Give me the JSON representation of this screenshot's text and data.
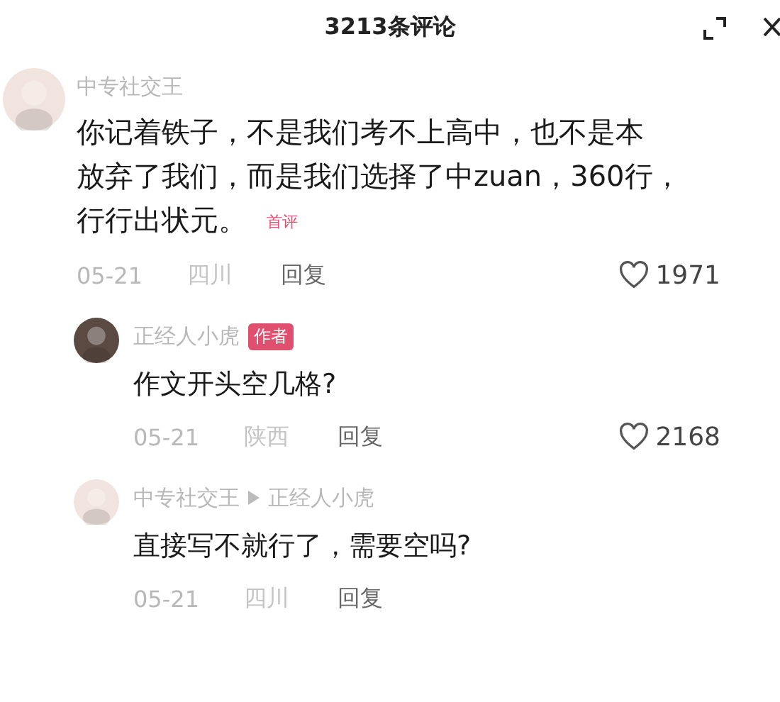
{
  "header": {
    "title": "3213条评论"
  },
  "comments": [
    {
      "kind": "top",
      "color": "#f1e4de",
      "names": [
        "中专社交王"
      ],
      "lines": [
        "你记着铁子，不是我们考不上高中，也不是本",
        "放弃了我们，而是我们选择了中zuan，360行，",
        "行行出状元。"
      ],
      "tag": "首评",
      "date": "05-21",
      "region": "四川",
      "reply": "回复",
      "likes": "1971"
    },
    {
      "kind": "reply",
      "color": "#5a4a42",
      "names": [
        "正经人小虎"
      ],
      "badge": "作者",
      "lines": [
        "作文开头空几格?"
      ],
      "date": "05-21",
      "region": "陕西",
      "reply": "回复",
      "likes": "2168"
    },
    {
      "kind": "reply",
      "color": "#f1e4de",
      "names": [
        "中专社交王",
        "正经人小虎"
      ],
      "lines": [
        "直接写不就行了，需要空吗?"
      ],
      "date": "05-21",
      "region": "四川",
      "reply": "回复"
    }
  ]
}
